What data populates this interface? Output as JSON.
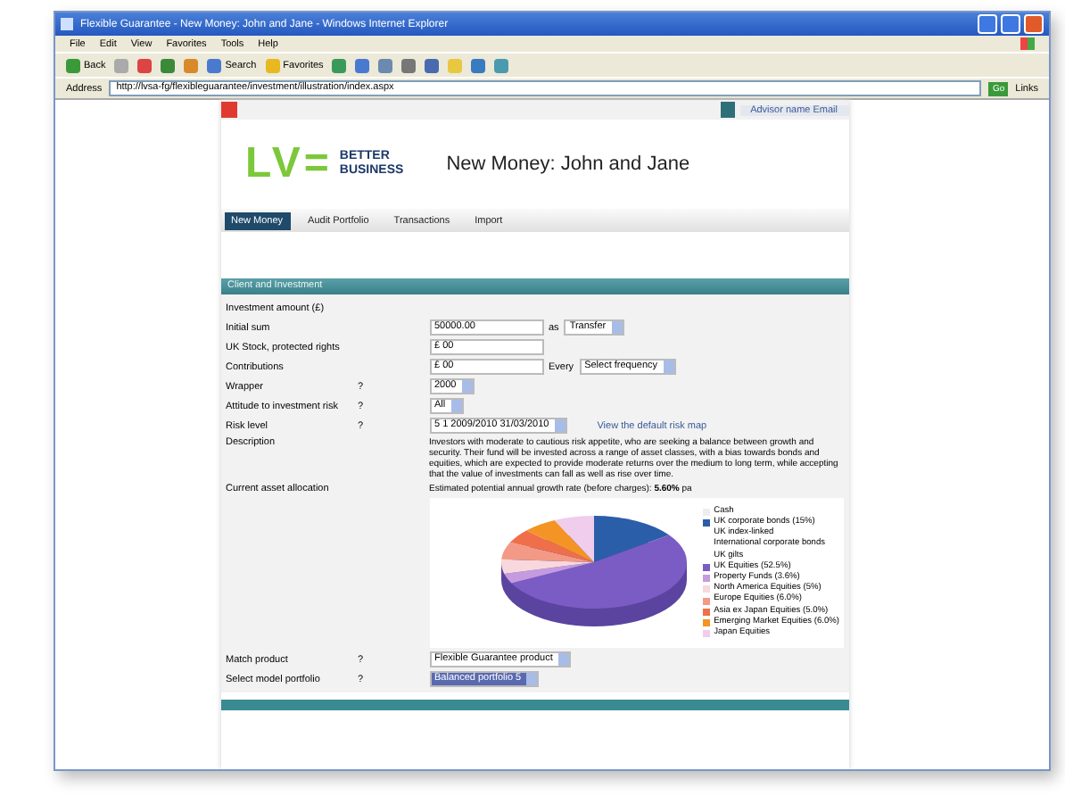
{
  "window": {
    "title": "Flexible Guarantee - New Money: John and Jane - Windows Internet Explorer"
  },
  "menu": [
    "File",
    "Edit",
    "View",
    "Favorites",
    "Tools",
    "Help"
  ],
  "toolbar": [
    {
      "kind": "back",
      "label": "Back"
    },
    {
      "kind": "forward"
    },
    {
      "kind": "stop"
    },
    {
      "kind": "refresh"
    },
    {
      "kind": "home"
    },
    {
      "kind": "search",
      "label": "Search"
    },
    {
      "kind": "favorites",
      "label": "Favorites"
    },
    {
      "kind": "media"
    },
    {
      "kind": "history"
    },
    {
      "kind": "mail"
    },
    {
      "kind": "print"
    },
    {
      "kind": "edit"
    },
    {
      "kind": "folder"
    },
    {
      "kind": "messenger"
    },
    {
      "kind": "research"
    }
  ],
  "address": {
    "label": "Address",
    "url": "http://lvsa-fg/flexibleguarantee/investment/illustration/index.aspx",
    "go": "Go",
    "links": "Links"
  },
  "page": {
    "top_link": "Advisor name Email",
    "brand": {
      "mark": "LV=",
      "tagline": [
        "BETTER",
        "BUSINESS"
      ]
    },
    "title": "New Money: John and Jane",
    "tabs": [
      {
        "label": "New Money",
        "selected": true
      },
      {
        "label": "Audit Portfolio",
        "selected": false
      },
      {
        "label": "Transactions",
        "selected": false
      },
      {
        "label": "Import",
        "selected": false
      }
    ],
    "section": "Client and Investment",
    "rows": [
      {
        "kind": "heading",
        "label": "Investment amount (£)"
      },
      {
        "kind": "amount",
        "label": "Initial sum",
        "value": "50000.00",
        "extra_label": "as",
        "select": "Transfer"
      },
      {
        "kind": "amount",
        "label": "UK Stock, protected rights",
        "value": "£ 00"
      },
      {
        "kind": "amount",
        "label": "Contributions",
        "value": "£ 00",
        "extra_label": "Every",
        "select": "Select frequency"
      },
      {
        "kind": "select",
        "label": "Wrapper",
        "help": "?",
        "select": "2000"
      },
      {
        "kind": "select",
        "label": "Attitude to investment risk",
        "help": "?",
        "select": "All"
      },
      {
        "kind": "risk",
        "label": "Risk level",
        "help": "?",
        "select": "5 1 2009/2010 31/03/2010",
        "link": "View the default risk map"
      },
      {
        "kind": "text",
        "label": "Description",
        "text": "Investors with moderate to cautious risk appetite, who are seeking a balance between growth and security. Their fund will be invested across a range of asset classes, with a bias towards bonds and equities, which are expected to provide moderate returns over the medium to long term, while accepting that the value of investments can fall as well as rise over time."
      },
      {
        "kind": "chart",
        "label": "Current asset allocation",
        "note": "Estimated potential annual growth rate (before charges): **5.60%** pa",
        "legend": [
          {
            "label": "Cash",
            "color": "#eeeeee"
          },
          {
            "label": "UK corporate bonds (15%)",
            "color": "#2a5ea8"
          },
          {
            "label": "UK index-linked"
          },
          {
            "label": "International corporate bonds"
          },
          {
            "label": "UK gilts"
          },
          {
            "label": "UK Equities (52.5%)",
            "color": "#7b5cc4"
          },
          {
            "label": "Property Funds (3.6%)",
            "color": "#c59be0"
          },
          {
            "label": "North America Equities (5%)",
            "color": "#f8d8dc"
          },
          {
            "label": "Europe Equities (6.0%)",
            "color": "#f29a86"
          },
          {
            "label": "Asia ex Japan Equities (5.0%)",
            "color": "#ef6f4a"
          },
          {
            "label": "Emerging Market Equities (6.0%)",
            "color": "#f39424"
          },
          {
            "label": "Japan Equities",
            "color": "#f0cdec"
          }
        ]
      },
      {
        "kind": "select",
        "label": "Match product",
        "help": "?",
        "select": "Flexible Guarantee product"
      },
      {
        "kind": "highlight",
        "label": "Select model portfolio",
        "help": "?",
        "select": "Balanced portfolio 5"
      }
    ]
  }
}
